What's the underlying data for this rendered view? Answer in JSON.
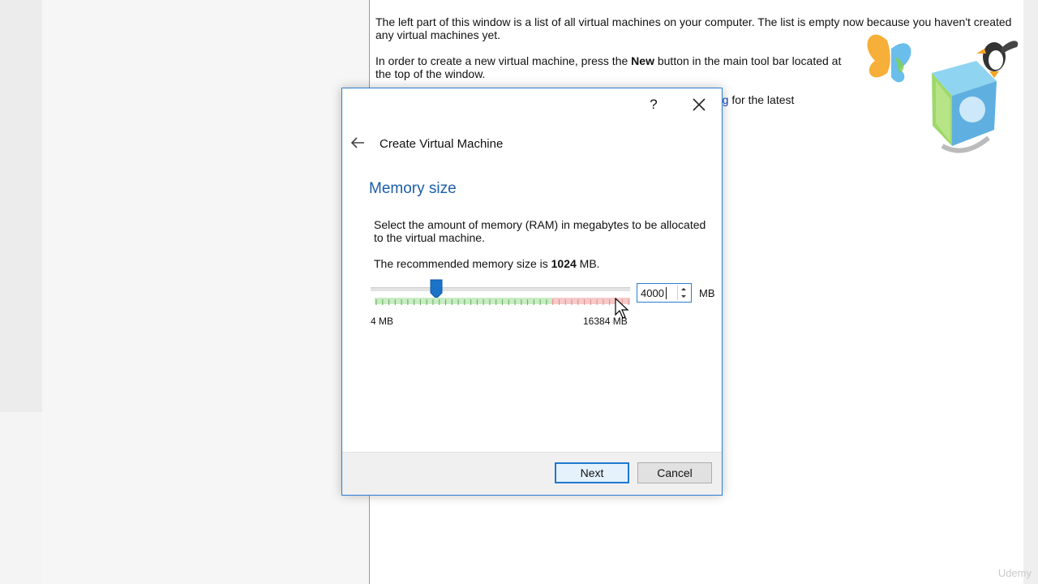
{
  "welcome": {
    "para1": "The left part of this window is a list of all virtual machines on your computer. The list is empty now because you haven't created any virtual machines yet.",
    "para2_before": "In order to create a new virtual machine, press the ",
    "para2_bold": "New",
    "para2_after": " button in the main tool bar located at the top of the window.",
    "para3_link": "rg",
    "para3_after": " for the latest"
  },
  "dialog": {
    "help_label": "?",
    "title": "Create Virtual Machine",
    "section_title": "Memory size",
    "description": "Select the amount of memory (RAM) in megabytes to be allocated to the virtual machine.",
    "recommend_prefix": "The recommended memory size is ",
    "recommend_value": "1024",
    "recommend_suffix": " MB.",
    "slider": {
      "min_label": "4 MB",
      "max_label": "16384 MB",
      "min": 4,
      "max": 16384,
      "value": 4000
    },
    "memory_value": "4000",
    "unit": "MB",
    "next_label": "Next",
    "cancel_label": "Cancel"
  },
  "watermark": "Udemy",
  "colors": {
    "accent": "#2b7fd4",
    "section_title": "#1c5ea7",
    "slider_safe": "#8fd18a",
    "slider_danger": "#f2a5a5"
  }
}
